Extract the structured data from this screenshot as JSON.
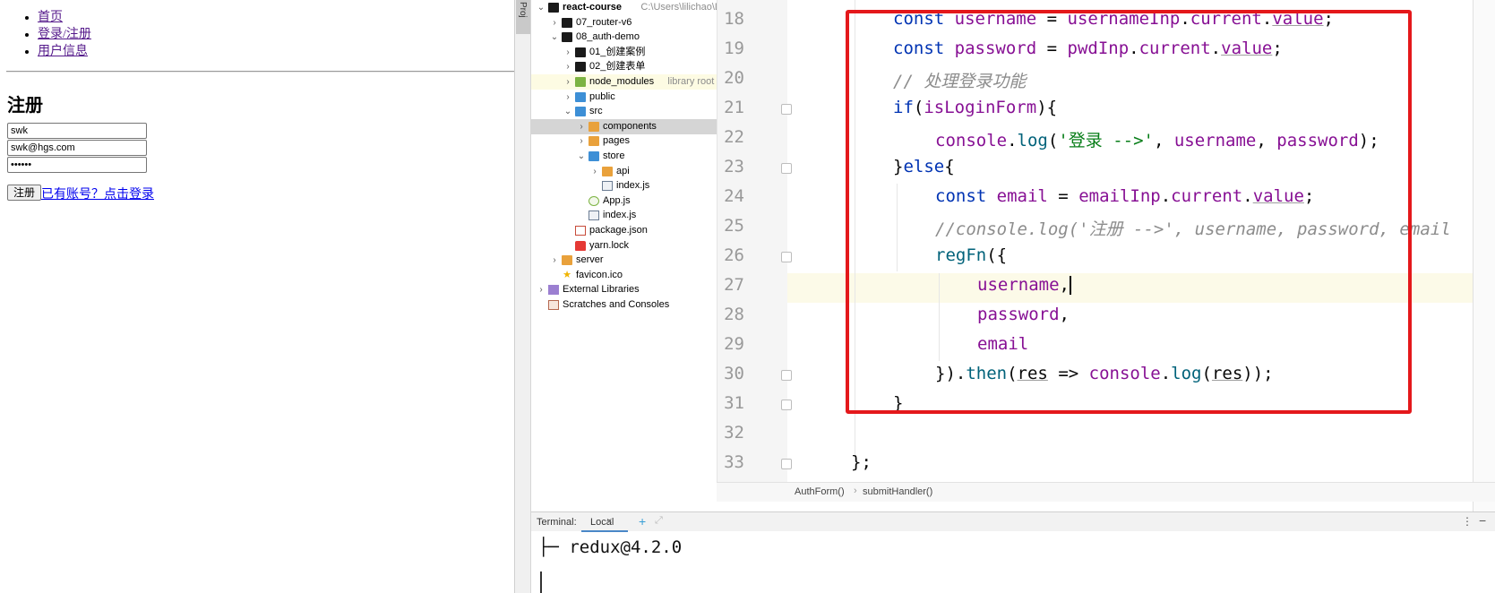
{
  "browser": {
    "nav": [
      "首页",
      "登录/注册",
      "用户信息"
    ],
    "heading": "注册",
    "username_value": "swk",
    "email_value": "swk@hgs.com",
    "password_value": "••••••",
    "register_button": "注册",
    "login_link": "已有账号？点击登录"
  },
  "ide": {
    "project_tab": "Proj",
    "tree": [
      {
        "label": "react-course",
        "hint": "C:\\Users\\lilichao\\De",
        "icon": "folder-black",
        "arrow": "v",
        "indent": 0,
        "bold": true
      },
      {
        "label": "07_router-v6",
        "icon": "folder-black",
        "arrow": ">",
        "indent": 1
      },
      {
        "label": "08_auth-demo",
        "icon": "folder-black",
        "arrow": "v",
        "indent": 1
      },
      {
        "label": "01_创建案例",
        "icon": "folder-black",
        "arrow": ">",
        "indent": 2
      },
      {
        "label": "02_创建表单",
        "icon": "folder-black",
        "arrow": ">",
        "indent": 2
      },
      {
        "label": "node_modules",
        "hint": "library root",
        "icon": "folder-green",
        "arrow": ">",
        "indent": 2,
        "hl": true
      },
      {
        "label": "public",
        "icon": "folder-blue",
        "arrow": ">",
        "indent": 2
      },
      {
        "label": "src",
        "icon": "folder-blue",
        "arrow": "v",
        "indent": 2
      },
      {
        "label": "components",
        "icon": "folder-orange",
        "arrow": ">",
        "indent": 3,
        "selected": true
      },
      {
        "label": "pages",
        "icon": "folder-orange",
        "arrow": ">",
        "indent": 3
      },
      {
        "label": "store",
        "icon": "folder-blue",
        "arrow": "v",
        "indent": 3
      },
      {
        "label": "api",
        "icon": "folder-orange",
        "arrow": ">",
        "indent": 4
      },
      {
        "label": "index.js",
        "icon": "file-js",
        "arrow": "",
        "indent": 4
      },
      {
        "label": "App.js",
        "icon": "file-react",
        "arrow": "",
        "indent": 3
      },
      {
        "label": "index.js",
        "icon": "file-js",
        "arrow": "",
        "indent": 3
      },
      {
        "label": "package.json",
        "icon": "file-json",
        "arrow": "",
        "indent": 2
      },
      {
        "label": "yarn.lock",
        "icon": "file-lock",
        "arrow": "",
        "indent": 2
      },
      {
        "label": "server",
        "icon": "folder-orange",
        "arrow": ">",
        "indent": 1
      },
      {
        "label": "favicon.ico",
        "icon": "file-star",
        "arrow": "",
        "indent": 1
      },
      {
        "label": "External Libraries",
        "icon": "file-lib",
        "arrow": ">",
        "indent": 0
      },
      {
        "label": "Scratches and Consoles",
        "icon": "file-scratch",
        "arrow": "",
        "indent": 0
      }
    ],
    "line_numbers": [
      "18",
      "19",
      "20",
      "21",
      "22",
      "23",
      "24",
      "25",
      "26",
      "27",
      "28",
      "29",
      "30",
      "31",
      "32",
      "33"
    ],
    "breadcrumb": [
      "AuthForm()",
      "submitHandler()"
    ],
    "terminal": {
      "title": "Terminal:",
      "tab": "Local",
      "line": "├─ redux@4.2.0"
    }
  }
}
